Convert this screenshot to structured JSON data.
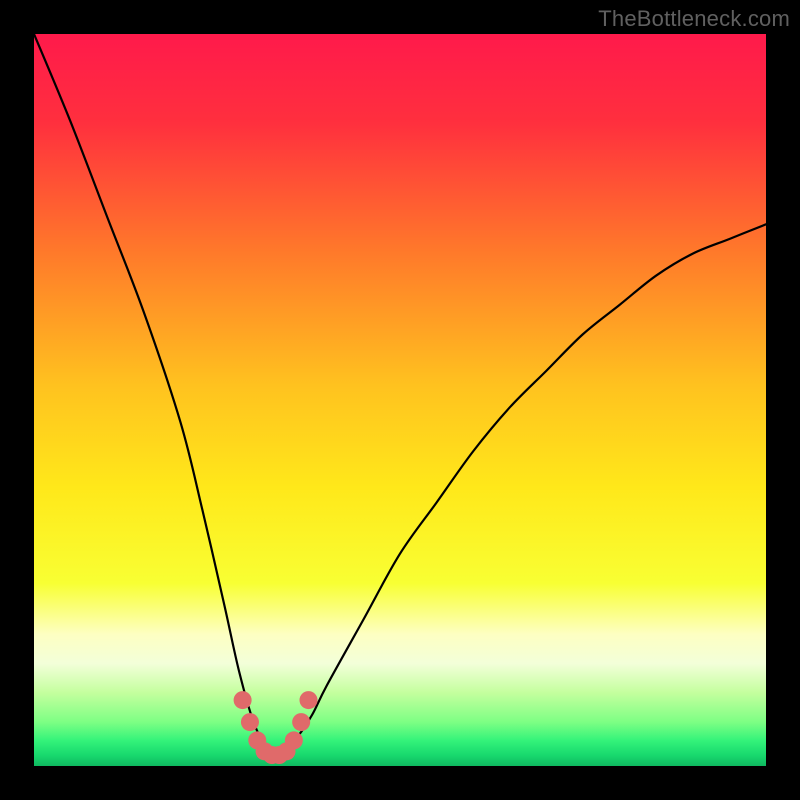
{
  "watermark": "TheBottleneck.com",
  "chart_data": {
    "type": "line",
    "title": "",
    "xlabel": "",
    "ylabel": "",
    "xlim": [
      0,
      100
    ],
    "ylim": [
      0,
      100
    ],
    "optimum_x": 33,
    "series": [
      {
        "name": "bottleneck-curve",
        "x": [
          0,
          5,
          10,
          15,
          20,
          23,
          26,
          28,
          30,
          32,
          33,
          34,
          36,
          38,
          40,
          45,
          50,
          55,
          60,
          65,
          70,
          75,
          80,
          85,
          90,
          95,
          100
        ],
        "values": [
          100,
          88,
          75,
          62,
          47,
          35,
          22,
          13,
          6,
          2,
          1.5,
          2,
          4,
          7,
          11,
          20,
          29,
          36,
          43,
          49,
          54,
          59,
          63,
          67,
          70,
          72,
          74
        ]
      }
    ],
    "highlight_dots": {
      "x": [
        28.5,
        29.5,
        30.5,
        31.5,
        32.5,
        33.5,
        34.5,
        35.5,
        36.5,
        37.5
      ],
      "y": [
        9.0,
        6.0,
        3.5,
        2.0,
        1.5,
        1.5,
        2.0,
        3.5,
        6.0,
        9.0
      ]
    },
    "gradient_stops": [
      {
        "offset": 0.0,
        "color": "#ff1a4b"
      },
      {
        "offset": 0.12,
        "color": "#ff2f3e"
      },
      {
        "offset": 0.3,
        "color": "#ff7a2a"
      },
      {
        "offset": 0.48,
        "color": "#ffc21f"
      },
      {
        "offset": 0.62,
        "color": "#ffe81a"
      },
      {
        "offset": 0.75,
        "color": "#f8ff33"
      },
      {
        "offset": 0.82,
        "color": "#fdffc2"
      },
      {
        "offset": 0.86,
        "color": "#f3ffd9"
      },
      {
        "offset": 0.9,
        "color": "#c4ff9e"
      },
      {
        "offset": 0.94,
        "color": "#7dff84"
      },
      {
        "offset": 0.965,
        "color": "#34f37a"
      },
      {
        "offset": 0.985,
        "color": "#18d96e"
      },
      {
        "offset": 1.0,
        "color": "#0fb860"
      }
    ]
  }
}
